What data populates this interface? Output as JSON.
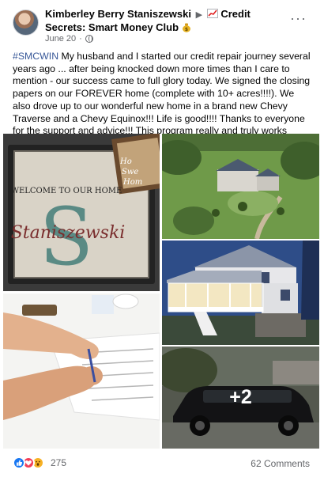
{
  "post": {
    "author": "Kimberley Berry Staniszewski",
    "group_name": "Credit Secrets: Smart Money Club",
    "date": "June 20",
    "more_label": "···",
    "hashtag": "#SMCWIN",
    "text": "My husband and I started our credit repair journey several years ago ... after being knocked down more times than I care to mention - our success came to full glory today. We signed the closing papers on our FOREVER home (complete with 10+ acres!!!!). We also drove up to our wonderful new home in a brand new Chevy Traverse and a Chevy Equinox!!! Life is good!!!! Thanks to everyone for the support and advice!!! This program really and truly works wonders!!!"
  },
  "photos": {
    "doormat_text": "WELCOME TO OUR HOME",
    "doormat_letter": "S",
    "doormat_name": "Staniszewski",
    "sign_text": [
      "Ho",
      "Swe",
      "Hom"
    ],
    "more_count": "+2"
  },
  "icons": {
    "verified_icon": "chart-increasing-icon",
    "moneybag_icon": "money-bag-icon",
    "globe": "globe-icon",
    "like": "like-reaction-icon",
    "love": "love-reaction-icon",
    "wow": "wow-reaction-icon"
  },
  "footer": {
    "reaction_count": "275",
    "comments": "62 Comments"
  },
  "colors": {
    "hashtag": "#385898",
    "like": "#1877f2",
    "love": "#f33e58",
    "wow": "#f7b125",
    "secondary_text": "#65676b"
  }
}
